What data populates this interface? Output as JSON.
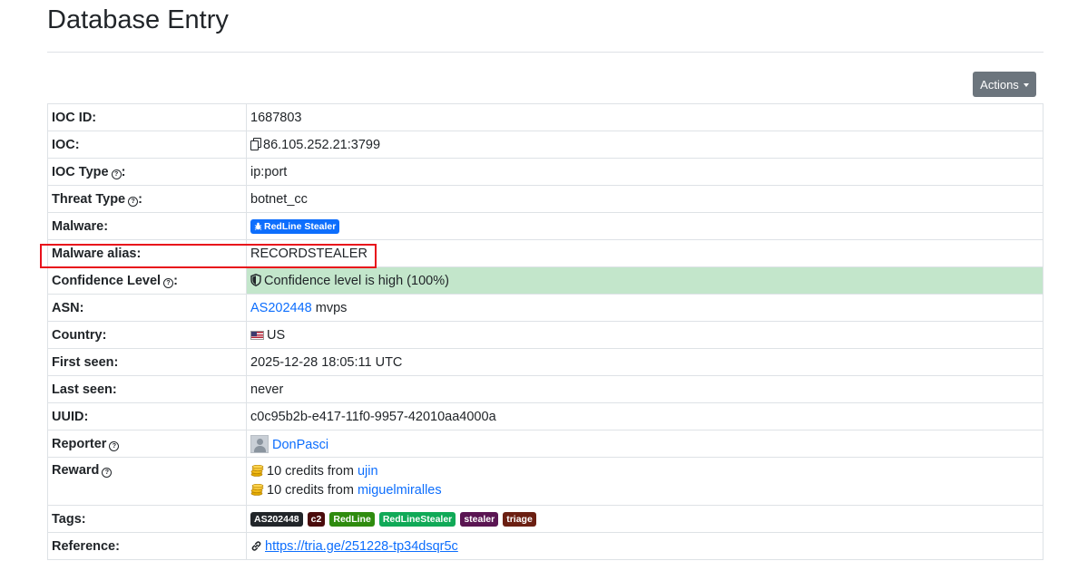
{
  "page": {
    "title": "Database Entry"
  },
  "actions": {
    "label": "Actions"
  },
  "rows": {
    "ioc_id": {
      "label": "IOC ID:",
      "value": "1687803"
    },
    "ioc": {
      "label": "IOC:",
      "value": "86.105.252.21:3799"
    },
    "ioc_type": {
      "label": "IOC Type",
      "suffix": ":",
      "value": "ip:port"
    },
    "threat_type": {
      "label": "Threat Type",
      "suffix": ":",
      "value": "botnet_cc"
    },
    "malware": {
      "label": "Malware:",
      "badge": "RedLine Stealer",
      "badge_color": "#0d6efd"
    },
    "malware_alias": {
      "label": "Malware alias:",
      "value": "RECORDSTEALER"
    },
    "confidence": {
      "label": "Confidence Level",
      "suffix": ":",
      "value": "Confidence level is high (100%)",
      "bg_color": "#c3e6cb"
    },
    "asn": {
      "label": "ASN:",
      "asn_link": "AS202448",
      "asn_name": "mvps"
    },
    "country": {
      "label": "Country:",
      "value": "US",
      "icon": "us-flag-icon"
    },
    "first_seen": {
      "label": "First seen:",
      "value": "2025-12-28 18:05:11 UTC"
    },
    "last_seen": {
      "label": "Last seen:",
      "value": "never"
    },
    "uuid": {
      "label": "UUID:",
      "value": "c0c95b2b-e417-11f0-9957-42010aa4000a"
    },
    "reporter": {
      "label": "Reporter",
      "value": "DonPasci"
    },
    "reward": {
      "label": "Reward",
      "items": [
        {
          "text": "10 credits from",
          "user": "ujin"
        },
        {
          "text": "10 credits from",
          "user": "miguelmiralles"
        }
      ]
    },
    "tags": {
      "label": "Tags:",
      "items": [
        {
          "text": "AS202448",
          "color": "#212529"
        },
        {
          "text": "c2",
          "color": "#4a0c0c"
        },
        {
          "text": "RedLine",
          "color": "#2e8b0e"
        },
        {
          "text": "RedLineStealer",
          "color": "#10a957"
        },
        {
          "text": "stealer",
          "color": "#5a1552"
        },
        {
          "text": "triage",
          "color": "#6b1f12"
        }
      ]
    },
    "reference": {
      "label": "Reference:",
      "value": "https://tria.ge/251228-tp34dsqr5c"
    }
  },
  "colors": {
    "accent": "#0d6efd",
    "highlight": "#e8101b",
    "button": "#6c757d"
  }
}
